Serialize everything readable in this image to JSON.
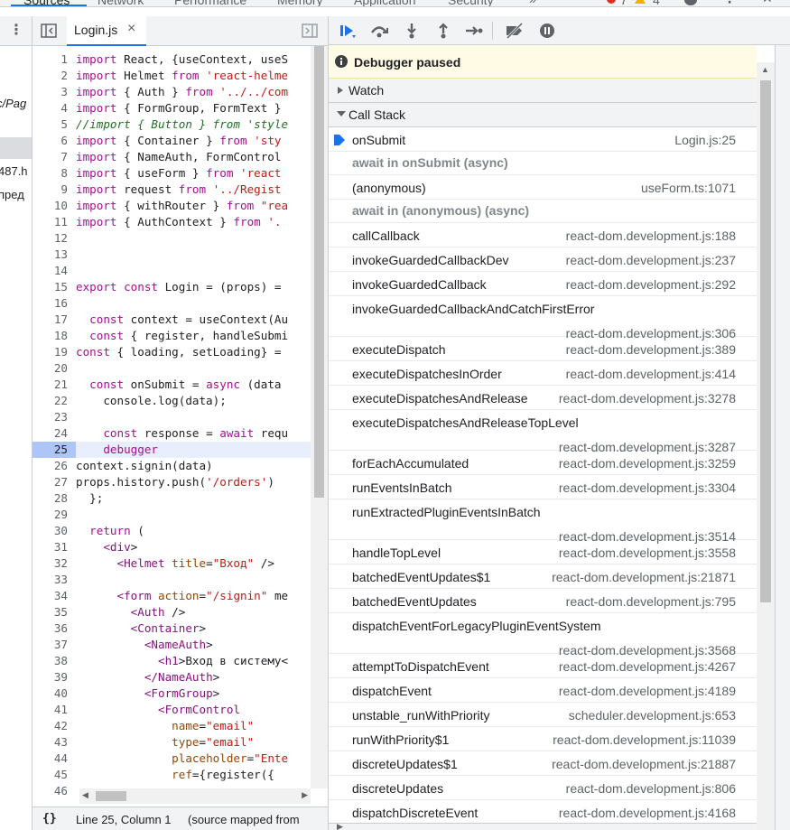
{
  "top_tabs": [
    {
      "label": "Sources",
      "active": true
    },
    {
      "label": "Network",
      "active": false
    },
    {
      "label": "Performance",
      "active": false
    },
    {
      "label": "Memory",
      "active": false
    },
    {
      "label": "Application",
      "active": false
    },
    {
      "label": "Security",
      "active": false
    }
  ],
  "top_bar": {
    "more_tabs_icon": "double-chevron-icon",
    "errors_count": "7",
    "warnings_count": "4",
    "settings_icon": "gear-icon",
    "menu_icon": "kebab-icon",
    "close_icon": "close-icon"
  },
  "navigator": {
    "fragments": [
      "c/Pag",
      "487.h",
      "пред"
    ]
  },
  "editor": {
    "tab_name": "Login.js",
    "tab_close": "×",
    "paused_line": 25,
    "lines": [
      {
        "n": "1",
        "text": "import React, {useContext, useS"
      },
      {
        "n": "2",
        "text": "import Helmet from 'react-helme"
      },
      {
        "n": "3",
        "text": "import { Auth } from '../../com"
      },
      {
        "n": "4",
        "text": "import { FormGroup, FormText }"
      },
      {
        "n": "5",
        "text": "//import { Button } from 'style"
      },
      {
        "n": "6",
        "text": "import { Container } from 'sty"
      },
      {
        "n": "7",
        "text": "import { NameAuth, FormControl"
      },
      {
        "n": "8",
        "text": "import { useForm } from 'react"
      },
      {
        "n": "9",
        "text": "import request from '../Regist"
      },
      {
        "n": "10",
        "text": "import { withRouter } from \"rea"
      },
      {
        "n": "11",
        "text": "import { AuthContext } from '."
      },
      {
        "n": "12",
        "text": ""
      },
      {
        "n": "13",
        "text": ""
      },
      {
        "n": "14",
        "text": ""
      },
      {
        "n": "15",
        "text": "export const Login = (props) ="
      },
      {
        "n": "16",
        "text": ""
      },
      {
        "n": "17",
        "text": "  const context = useContext(Au"
      },
      {
        "n": "18",
        "text": "  const { register, handleSubmi"
      },
      {
        "n": "19",
        "text": "const { loading, setLoading} ="
      },
      {
        "n": "20",
        "text": ""
      },
      {
        "n": "21",
        "text": "  const onSubmit = async (data"
      },
      {
        "n": "22",
        "text": "    console.log(data);"
      },
      {
        "n": "23",
        "text": ""
      },
      {
        "n": "24",
        "text": "    const response = await requ"
      },
      {
        "n": "25",
        "text": "    debugger"
      },
      {
        "n": "26",
        "text": "context.signin(data)"
      },
      {
        "n": "27",
        "text": "props.history.push('/orders')"
      },
      {
        "n": "28",
        "text": "  };"
      },
      {
        "n": "29",
        "text": ""
      },
      {
        "n": "30",
        "text": "  return ("
      },
      {
        "n": "31",
        "text": "    <div>"
      },
      {
        "n": "32",
        "text": "      <Helmet title=\"Вход\" />"
      },
      {
        "n": "33",
        "text": ""
      },
      {
        "n": "34",
        "text": "      <form action=\"/signin\" me"
      },
      {
        "n": "35",
        "text": "        <Auth />"
      },
      {
        "n": "36",
        "text": "        <Container>"
      },
      {
        "n": "37",
        "text": "          <NameAuth>"
      },
      {
        "n": "38",
        "text": "            <h1>Вход в систему<"
      },
      {
        "n": "39",
        "text": "          </NameAuth>"
      },
      {
        "n": "40",
        "text": "          <FormGroup>"
      },
      {
        "n": "41",
        "text": "            <FormControl"
      },
      {
        "n": "42",
        "text": "              name=\"email\""
      },
      {
        "n": "43",
        "text": "              type=\"email\""
      },
      {
        "n": "44",
        "text": "              placeholder=\"Ente"
      },
      {
        "n": "45",
        "text": "              ref={register({"
      },
      {
        "n": "46",
        "text": ""
      }
    ]
  },
  "status_bar": {
    "format_icon": "{}",
    "position": "Line 25, Column 1",
    "source_mapped": "(source mapped from"
  },
  "debugger": {
    "paused_text": "Debugger paused",
    "watch_label": "Watch",
    "call_stack_label": "Call Stack",
    "call_stack": [
      {
        "kind": "frame",
        "name": "onSubmit",
        "location": "Login.js:25",
        "selected": true
      },
      {
        "kind": "async",
        "name": "await in onSubmit (async)"
      },
      {
        "kind": "frame",
        "name": "(anonymous)",
        "location": "useForm.ts:1071"
      },
      {
        "kind": "async",
        "name": "await in (anonymous) (async)"
      },
      {
        "kind": "frame",
        "name": "callCallback",
        "location": "react-dom.development.js:188"
      },
      {
        "kind": "frame",
        "name": "invokeGuardedCallbackDev",
        "location": "react-dom.development.js:237"
      },
      {
        "kind": "frame",
        "name": "invokeGuardedCallback",
        "location": "react-dom.development.js:292"
      },
      {
        "kind": "frame2",
        "name": "invokeGuardedCallbackAndCatchFirstError",
        "location": "react-dom.development.js:306"
      },
      {
        "kind": "frame",
        "name": "executeDispatch",
        "location": "react-dom.development.js:389"
      },
      {
        "kind": "frame",
        "name": "executeDispatchesInOrder",
        "location": "react-dom.development.js:414"
      },
      {
        "kind": "frame",
        "name": "executeDispatchesAndRelease",
        "location": "react-dom.development.js:3278"
      },
      {
        "kind": "frame2",
        "name": "executeDispatchesAndReleaseTopLevel",
        "location": "react-dom.development.js:3287"
      },
      {
        "kind": "frame",
        "name": "forEachAccumulated",
        "location": "react-dom.development.js:3259"
      },
      {
        "kind": "frame",
        "name": "runEventsInBatch",
        "location": "react-dom.development.js:3304"
      },
      {
        "kind": "frame2",
        "name": "runExtractedPluginEventsInBatch",
        "location": "react-dom.development.js:3514"
      },
      {
        "kind": "frame",
        "name": "handleTopLevel",
        "location": "react-dom.development.js:3558"
      },
      {
        "kind": "frame",
        "name": "batchedEventUpdates$1",
        "location": "react-dom.development.js:21871"
      },
      {
        "kind": "frame",
        "name": "batchedEventUpdates",
        "location": "react-dom.development.js:795"
      },
      {
        "kind": "frame2",
        "name": "dispatchEventForLegacyPluginEventSystem",
        "location": "react-dom.development.js:3568"
      },
      {
        "kind": "frame",
        "name": "attemptToDispatchEvent",
        "location": "react-dom.development.js:4267"
      },
      {
        "kind": "frame",
        "name": "dispatchEvent",
        "location": "react-dom.development.js:4189"
      },
      {
        "kind": "frame",
        "name": "unstable_runWithPriority",
        "location": "scheduler.development.js:653"
      },
      {
        "kind": "frame",
        "name": "runWithPriority$1",
        "location": "react-dom.development.js:11039"
      },
      {
        "kind": "frame",
        "name": "discreteUpdates$1",
        "location": "react-dom.development.js:21887"
      },
      {
        "kind": "frame",
        "name": "discreteUpdates",
        "location": "react-dom.development.js:806"
      },
      {
        "kind": "frame",
        "name": "dispatchDiscreteEvent",
        "location": "react-dom.development.js:4168"
      }
    ]
  },
  "colors": {
    "accent": "#1a73e8",
    "paused_banner_bg": "#fffbe5",
    "paused_line_bg": "#aec5f7",
    "error": "#d93025",
    "warning": "#f9ab00"
  }
}
